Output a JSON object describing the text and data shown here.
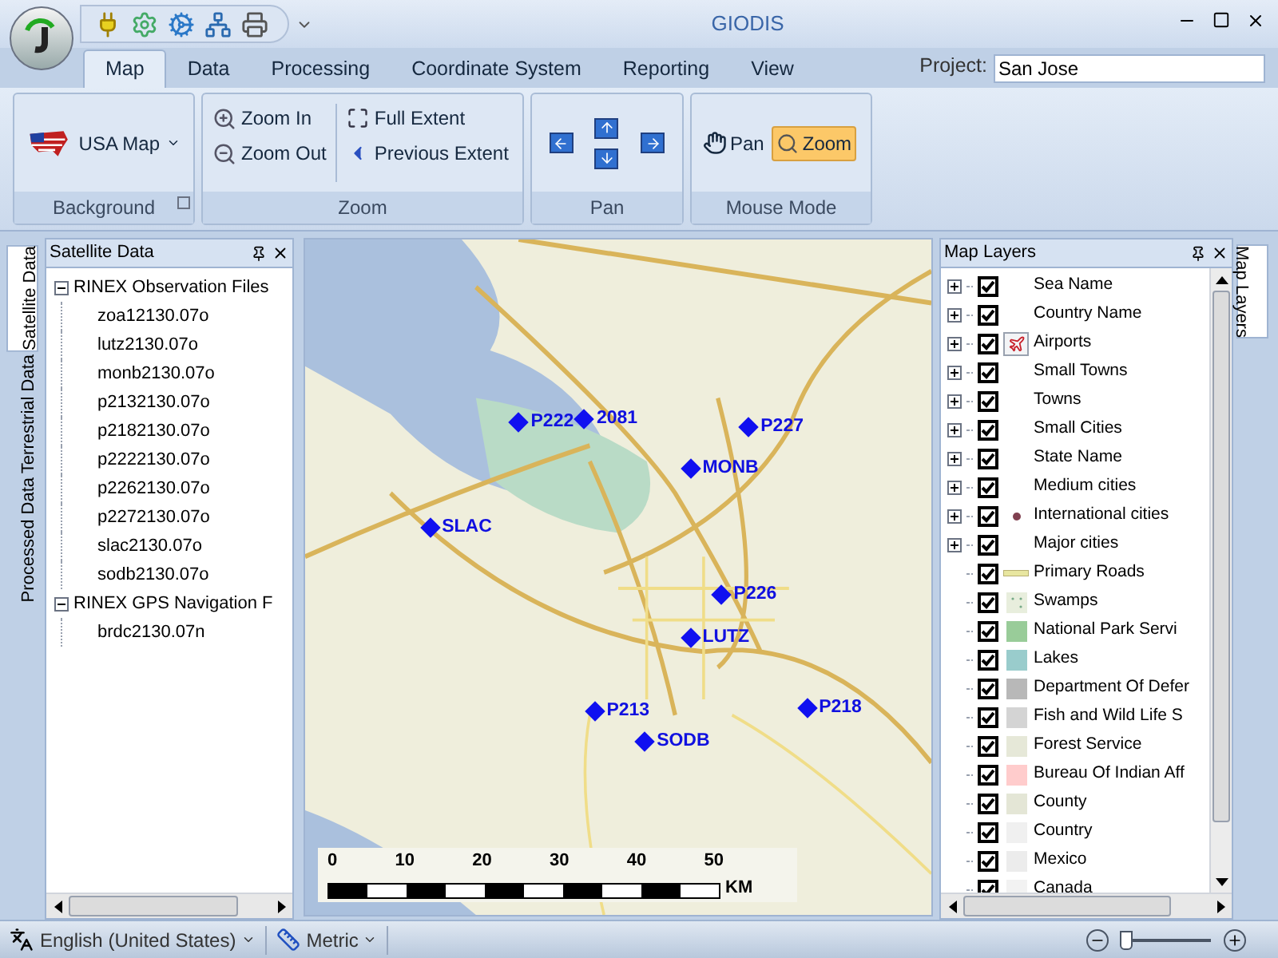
{
  "window": {
    "title": "GIODIS"
  },
  "tabs": [
    {
      "label": "Map",
      "selected": true
    },
    {
      "label": "Data",
      "selected": false
    },
    {
      "label": "Processing",
      "selected": false
    },
    {
      "label": "Coordinate System",
      "selected": false
    },
    {
      "label": "Reporting",
      "selected": false
    },
    {
      "label": "View",
      "selected": false
    }
  ],
  "project": {
    "label": "Project:",
    "value": "San Jose"
  },
  "ribbon": {
    "background": {
      "button": "USA Map",
      "label": "Background"
    },
    "zoom": {
      "items": [
        "Zoom In",
        "Zoom Out",
        "Full Extent",
        "Previous Extent"
      ],
      "label": "Zoom"
    },
    "pan": {
      "label": "Pan"
    },
    "mouse_mode": {
      "items": [
        {
          "label": "Pan",
          "selected": false
        },
        {
          "label": "Zoom",
          "selected": true
        }
      ],
      "label": "Mouse Mode"
    }
  },
  "left_tabs": [
    {
      "label": "Satellite Data",
      "selected": true
    },
    {
      "label": "Terrestrial Data",
      "selected": false
    },
    {
      "label": "Processed Data",
      "selected": false
    }
  ],
  "satellite_panel": {
    "title": "Satellite Data",
    "tree": [
      {
        "label": "RINEX Observation Files",
        "expanded": true,
        "children": [
          {
            "label": "zoa12130.07o"
          },
          {
            "label": "lutz2130.07o"
          },
          {
            "label": "monb2130.07o"
          },
          {
            "label": "p2132130.07o"
          },
          {
            "label": "p2182130.07o"
          },
          {
            "label": "p2222130.07o"
          },
          {
            "label": "p2262130.07o"
          },
          {
            "label": "p2272130.07o"
          },
          {
            "label": "slac2130.07o"
          },
          {
            "label": "sodb2130.07o"
          }
        ]
      },
      {
        "label": "RINEX GPS Navigation F",
        "expanded": true,
        "children": [
          {
            "label": "brdc2130.07n"
          }
        ]
      }
    ]
  },
  "map": {
    "stations": [
      {
        "label": "P222"
      },
      {
        "label": "2081"
      },
      {
        "label": "P227"
      },
      {
        "label": "MONB"
      },
      {
        "label": "SLAC"
      },
      {
        "label": "P226"
      },
      {
        "label": "LUTZ"
      },
      {
        "label": "P213"
      },
      {
        "label": "P218"
      },
      {
        "label": "SODB"
      }
    ],
    "scale": {
      "ticks": [
        "0",
        "10",
        "20",
        "30",
        "40",
        "50"
      ],
      "unit": "KM"
    }
  },
  "layers_panel": {
    "title": "Map Layers",
    "items": [
      {
        "label": "Sea Name",
        "kind": "group",
        "expanded": false,
        "checked": true
      },
      {
        "label": "Country Name",
        "kind": "group",
        "expanded": false,
        "checked": true
      },
      {
        "label": "Airports",
        "kind": "airport",
        "expanded": false,
        "checked": true
      },
      {
        "label": "Small Towns",
        "kind": "group",
        "expanded": false,
        "checked": true
      },
      {
        "label": "Towns",
        "kind": "group",
        "expanded": false,
        "checked": true
      },
      {
        "label": "Small Cities",
        "kind": "group",
        "expanded": false,
        "checked": true
      },
      {
        "label": "State Name",
        "kind": "group",
        "expanded": false,
        "checked": true
      },
      {
        "label": "Medium cities",
        "kind": "group",
        "expanded": false,
        "checked": true
      },
      {
        "label": "International cities",
        "kind": "point",
        "expanded": false,
        "checked": true
      },
      {
        "label": "Major cities",
        "kind": "group",
        "expanded": false,
        "checked": true
      },
      {
        "label": "Primary Roads",
        "kind": "line",
        "checked": true
      },
      {
        "label": "Swamps",
        "kind": "pattern",
        "checked": true
      },
      {
        "label": "National Park Servi",
        "kind": "fill",
        "color": "#99cc99",
        "checked": true
      },
      {
        "label": "Lakes",
        "kind": "fill",
        "color": "#99cccc",
        "checked": true
      },
      {
        "label": "Department Of Defer",
        "kind": "fill",
        "color": "#b8b8b8",
        "checked": true
      },
      {
        "label": "Fish and Wild Life S",
        "kind": "fill",
        "color": "#d4d4d4",
        "checked": true
      },
      {
        "label": "Forest Service",
        "kind": "fill",
        "color": "#e6e8d8",
        "checked": true
      },
      {
        "label": "Bureau Of Indian Aff",
        "kind": "fill",
        "color": "#ffcccc",
        "checked": true
      },
      {
        "label": "County",
        "kind": "fill",
        "color": "#e4e6d6",
        "checked": true
      },
      {
        "label": "Country",
        "kind": "fill",
        "color": "#f0f0f0",
        "checked": true
      },
      {
        "label": "Mexico",
        "kind": "fill",
        "color": "#ececec",
        "checked": true
      },
      {
        "label": "Canada",
        "kind": "fill",
        "color": "#f2f2f2",
        "checked": true
      }
    ]
  },
  "right_tabs": [
    {
      "label": "Map Layers",
      "selected": true
    }
  ],
  "status_bar": {
    "language": "English (United States)",
    "units": "Metric",
    "zoom": {
      "level": 0.06
    }
  }
}
